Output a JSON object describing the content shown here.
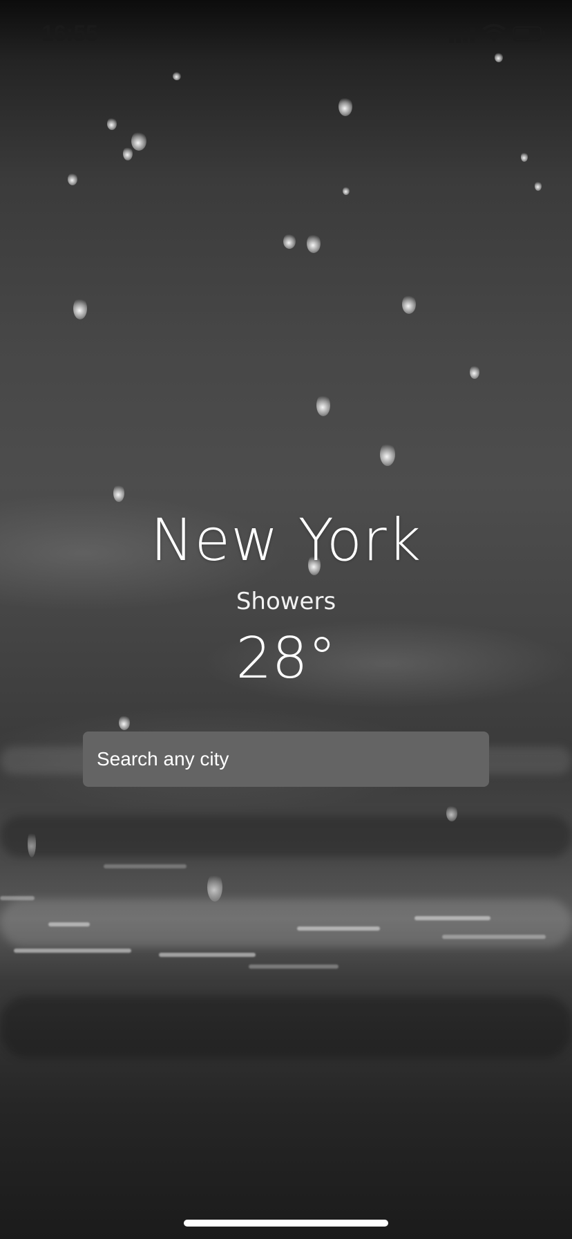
{
  "status_bar": {
    "time": "16:55",
    "signal_icon": "cellular-signal-icon",
    "wifi_icon": "wifi-icon",
    "battery_icon": "battery-icon"
  },
  "weather": {
    "city": "New York",
    "condition": "Showers",
    "temperature": "28°"
  },
  "search": {
    "placeholder": "Search any city",
    "value": ""
  },
  "background": {
    "description_icon": "rain-water-background",
    "tint": "#4a4a4a"
  },
  "colors": {
    "search_box": "#646464",
    "text": "#ffffff",
    "status_text": "#1a1a1a"
  }
}
